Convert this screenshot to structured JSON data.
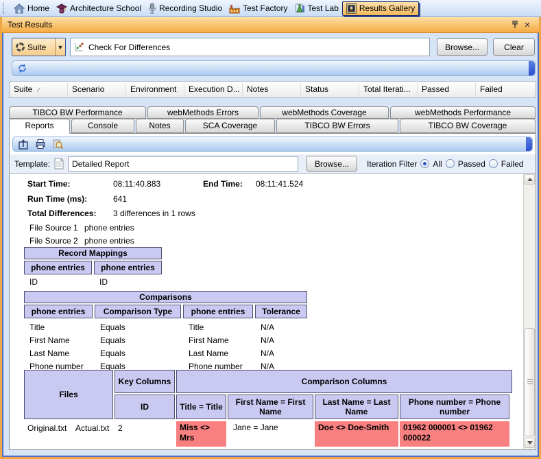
{
  "colors": {
    "accent_orange": "#f0a846",
    "titlebar_gradient_top": "#fddfa6",
    "titlebar_gradient_bottom": "#f5ab43",
    "panel_blue": "#4c70cc",
    "table_header_lavender": "#c9c9f2",
    "diff_red": "#f88080"
  },
  "app_toolbar": {
    "items": [
      {
        "label": "Home",
        "icon": "home-icon"
      },
      {
        "label": "Architecture School",
        "icon": "architecture-school-icon"
      },
      {
        "label": "Recording Studio",
        "icon": "microphone-icon"
      },
      {
        "label": "Test Factory",
        "icon": "factory-icon"
      },
      {
        "label": "Test Lab",
        "icon": "flask-icon"
      },
      {
        "label": "Results Gallery",
        "icon": "gallery-icon",
        "active": true
      }
    ]
  },
  "window": {
    "title": "Test Results"
  },
  "suite_bar": {
    "suite_button_label": "Suite",
    "suite_value": "Check For Differences",
    "browse_label": "Browse...",
    "clear_label": "Clear"
  },
  "results_table": {
    "columns": [
      "Suite",
      "Scenario",
      "Environment",
      "Execution D...",
      "Notes",
      "Status",
      "Total Iterati...",
      "Passed",
      "Failed"
    ]
  },
  "tabs": {
    "row1": [
      "TIBCO BW Performance",
      "webMethods Errors",
      "webMethods Coverage",
      "webMethods Performance"
    ],
    "row2": [
      "Reports",
      "Console",
      "Notes",
      "SCA Coverage",
      "TIBCO BW Errors",
      "TIBCO BW Coverage"
    ],
    "active_tab": "Reports"
  },
  "report_toolbar": {
    "template_label": "Template:",
    "template_value": "Detailed Report",
    "browse_label": "Browse...",
    "iteration_filter_label": "Iteration Filter",
    "filters": [
      "All",
      "Passed",
      "Failed"
    ],
    "selected_filter": "All"
  },
  "report": {
    "summary": {
      "start_time_label": "Start Time:",
      "start_time": "08:11:40.883",
      "end_time_label": "End Time:",
      "end_time": "08:11:41.524",
      "run_time_label": "Run Time (ms):",
      "run_time": "641",
      "total_differences_label": "Total Differences:",
      "total_differences": "3 differences in 1 rows"
    },
    "file_sources": [
      {
        "label": "File Source 1",
        "value": "phone entries"
      },
      {
        "label": "File Source 2",
        "value": "phone entries"
      }
    ],
    "record_mappings": {
      "title": "Record Mappings",
      "columns": [
        "phone entries",
        "phone entries"
      ],
      "rows": [
        [
          "ID",
          "ID"
        ]
      ]
    },
    "comparisons": {
      "title": "Comparisons",
      "columns": [
        "phone entries",
        "Comparison Type",
        "phone entries",
        "Tolerance"
      ],
      "rows": [
        [
          "Title",
          "Equals",
          "Title",
          "N/A"
        ],
        [
          "First Name",
          "Equals",
          "First Name",
          "N/A"
        ],
        [
          "Last Name",
          "Equals",
          "Last Name",
          "N/A"
        ],
        [
          "Phone number",
          "Equals",
          "Phone number",
          "N/A"
        ]
      ]
    },
    "files_table": {
      "files_header": "Files",
      "key_columns_header": "Key Columns",
      "comparison_columns_header": "Comparison Columns",
      "key_column_name": "ID",
      "comparison_headers": [
        "Title = Title",
        "First Name = First Name",
        "Last Name = Last Name",
        "Phone number = Phone number"
      ],
      "data_row": {
        "file1": "Original.txt",
        "file2": "Actual.txt",
        "key_value": "2",
        "cells": [
          {
            "text": "Miss <> Mrs",
            "diff": true
          },
          {
            "text": "Jane = Jane",
            "diff": false
          },
          {
            "text": "Doe <> Doe-Smith",
            "diff": true
          },
          {
            "text": "01962 000001 <> 01962 000022",
            "diff": true
          }
        ]
      }
    }
  }
}
